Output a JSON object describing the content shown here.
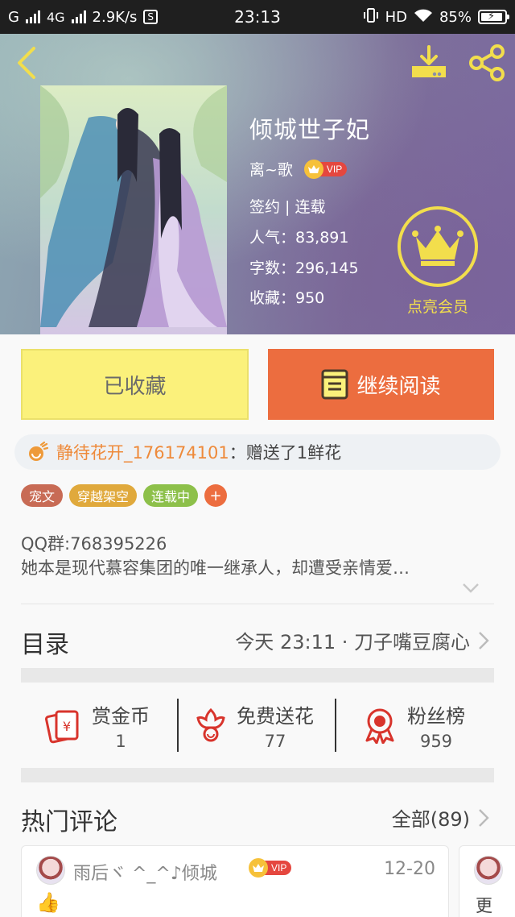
{
  "status_bar": {
    "carrier": "G",
    "network": "4G",
    "speed": "2.9K/s",
    "s_icon": "S",
    "time": "23:13",
    "hd": "HD",
    "battery": "85%"
  },
  "book": {
    "title": "倾城世子妃",
    "author": "离~歌",
    "vip": "VIP",
    "status": "签约 | 连载",
    "popularity": "人气：83,891",
    "word_count": "字数：296,145",
    "favorites": "收藏：950",
    "member_label": "点亮会员"
  },
  "actions": {
    "favorited": "已收藏",
    "continue_reading": "继续阅读"
  },
  "gift": {
    "user": "静待花开_176174101",
    "message": "：赠送了1鲜花"
  },
  "tags": [
    {
      "label": "宠文",
      "color": "#c86b55"
    },
    {
      "label": "穿越架空",
      "color": "#e0a93c"
    },
    {
      "label": "连载中",
      "color": "#8dc04a"
    }
  ],
  "tag_add": "+",
  "intro": {
    "line1": "QQ群:768395226",
    "line2": "她本是现代慕容集团的唯一继承人，却遭受亲情爱…"
  },
  "toc": {
    "title": "目录",
    "latest": "今天 23:11 · 刀子嘴豆腐心"
  },
  "stats": [
    {
      "label": "赏金币",
      "value": "1"
    },
    {
      "label": "免费送花",
      "value": "77"
    },
    {
      "label": "粉丝榜",
      "value": "959"
    }
  ],
  "comments": {
    "title": "热门评论",
    "all": "全部(89)",
    "first": {
      "user": "雨后ヾ ^_^♪倾城",
      "vip": "VIP",
      "date": "12-20",
      "emoji": "👍"
    },
    "second_preview": "更"
  },
  "colors": {
    "accent_orange": "#ec6d3f",
    "fav_yellow": "#fbf17b",
    "gold": "#f2de4c"
  }
}
